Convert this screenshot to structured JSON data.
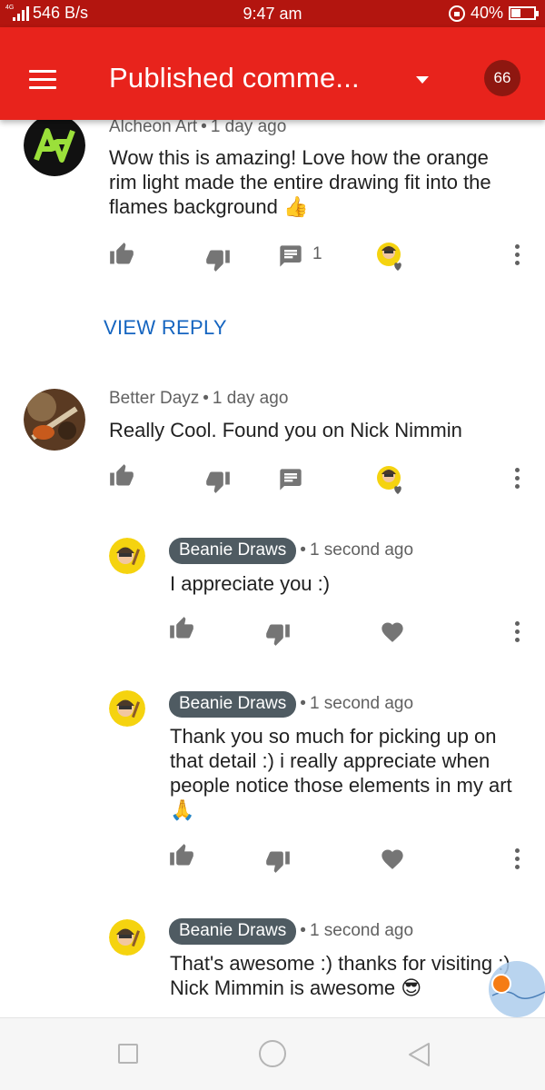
{
  "status_bar": {
    "network": "4G",
    "speed": "546 B/s",
    "time": "9:47 am",
    "battery": "40%",
    "battery_level": 0.4
  },
  "header": {
    "title": "Published comme...",
    "count": "66"
  },
  "comments": [
    {
      "author": "Alcheon Art",
      "time": "1 day ago",
      "text": "Wow this is amazing! Love how the orange rim light made the entire drawing fit into the flames background 👍",
      "reply_count": "1",
      "view_reply": "VIEW REPLY"
    },
    {
      "author": "Better Dayz",
      "time": "1 day ago",
      "text": "Really Cool. Found you on Nick Nimmin"
    }
  ],
  "replies": [
    {
      "author": "Beanie Draws",
      "time": "1 second ago",
      "text": "I appreciate you :)"
    },
    {
      "author": "Beanie Draws",
      "time": "1 second ago",
      "text": "Thank you so much for picking up on that detail :) i really appreciate when people notice those elements in my art 🙏"
    },
    {
      "author": "Beanie Draws",
      "time": "1 second ago",
      "text": "That's awesome :) thanks for visiting :) Nick Mimmin is awesome 😎"
    }
  ],
  "colors": {
    "status_bar": "#b3150f",
    "header": "#e8231c",
    "badge": "#8e1710",
    "link": "#1565c0",
    "owner_chip": "#4f5b62"
  }
}
